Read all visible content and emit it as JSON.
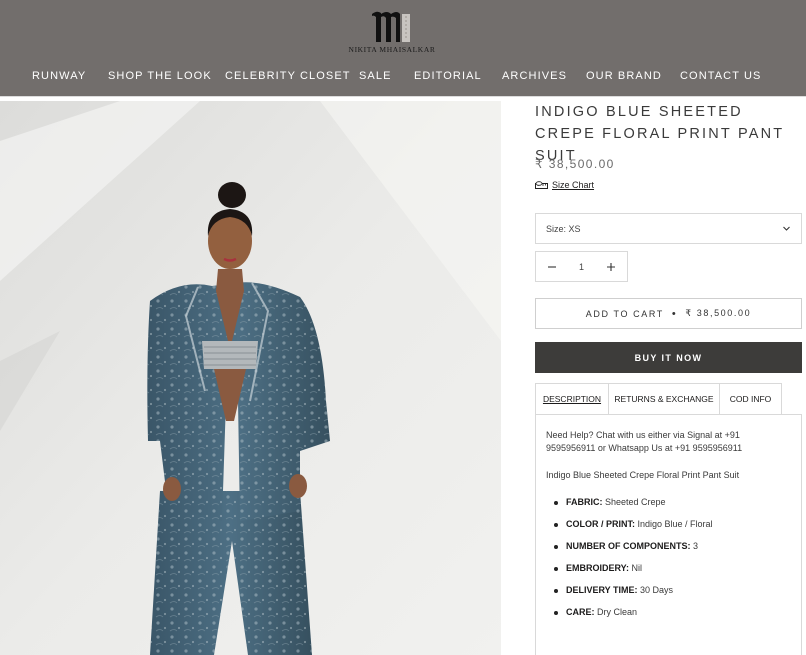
{
  "brand": {
    "logo_text": "NIKITA MHAISALKAR",
    "logo_icon": "nm-monogram-icon"
  },
  "nav": {
    "items": [
      {
        "label": "RUNWAY"
      },
      {
        "label": "SHOP THE LOOK"
      },
      {
        "label": "CELEBRITY CLOSET"
      },
      {
        "label": "SALE"
      },
      {
        "label": "EDITORIAL"
      },
      {
        "label": "ARCHIVES"
      },
      {
        "label": "OUR BRAND"
      },
      {
        "label": "CONTACT US"
      }
    ]
  },
  "product": {
    "title": "INDIGO BLUE SHEETED CREPE FLORAL PRINT PANT SUIT",
    "price": "₹ 38,500.00",
    "size_chart_label": "Size Chart",
    "size_chart_icon": "ruler-icon",
    "size_select": "Size: XS",
    "quantity": "1",
    "add_to_cart_label": "ADD TO CART",
    "add_to_cart_price": "₹ 38,500.00",
    "buy_now_label": "BUY IT NOW"
  },
  "tabs": [
    {
      "label": "DESCRIPTION"
    },
    {
      "label": "RETURNS & EXCHANGE"
    },
    {
      "label": "COD INFO"
    }
  ],
  "description": {
    "help_text": "Need Help? Chat with us either via Signal at +91 9595956911 or Whatsapp Us at +91 9595956911",
    "summary": "Indigo Blue Sheeted Crepe Floral Print Pant Suit",
    "attributes": [
      {
        "key": "FABRIC:",
        "value": "Sheeted Crepe"
      },
      {
        "key": "COLOR / PRINT:",
        "value": "Indigo Blue / Floral"
      },
      {
        "key": "NUMBER OF COMPONENTS:",
        "value": "3"
      },
      {
        "key": "EMBROIDERY:",
        "value": "Nil"
      },
      {
        "key": "DELIVERY TIME:",
        "value": "30 Days"
      },
      {
        "key": "CARE:",
        "value": "Dry Clean"
      }
    ]
  },
  "colors": {
    "header_bg": "#726e6c",
    "buy_now_bg": "#3d3c3a",
    "suit": "#3e5f75"
  }
}
